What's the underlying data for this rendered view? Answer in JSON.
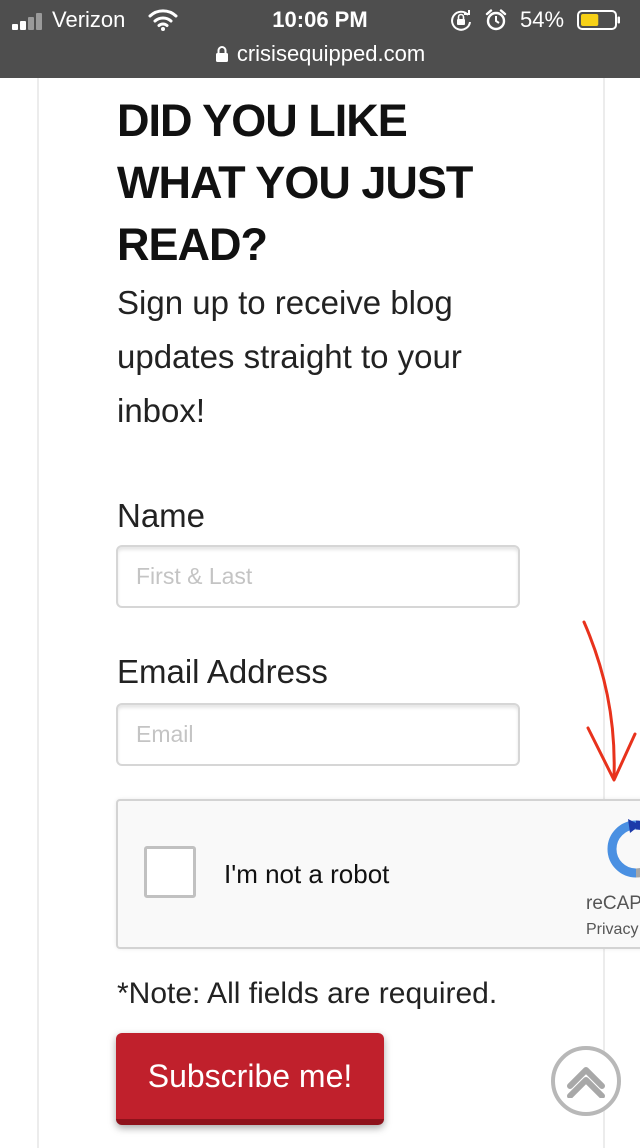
{
  "status_bar": {
    "carrier": "Verizon",
    "time": "10:06 PM",
    "battery_percent": "54%",
    "battery_level": 0.54,
    "url": "crisisequipped.com",
    "icons": [
      "signal-icon",
      "wifi-icon",
      "orientation-lock-icon",
      "alarm-icon",
      "battery-icon",
      "padlock-icon"
    ]
  },
  "signup": {
    "heading": "DID YOU LIKE WHAT YOU JUST READ?",
    "subtext": "Sign up to receive blog updates straight to your inbox!",
    "name_label": "Name",
    "name_placeholder": "First & Last",
    "email_label": "Email Address",
    "email_placeholder": "Email",
    "note": "*Note: All fields are required.",
    "submit_label": "Subscribe me!"
  },
  "recaptcha": {
    "label": "I'm not a robot",
    "brand": "reCAP",
    "links": "Privacy",
    "checked": false
  },
  "colors": {
    "status_bar_bg": "#4e4e4e",
    "button_red": "#c0202c",
    "annotation_red": "#e8321c",
    "battery_yellow": "#f7d117"
  }
}
